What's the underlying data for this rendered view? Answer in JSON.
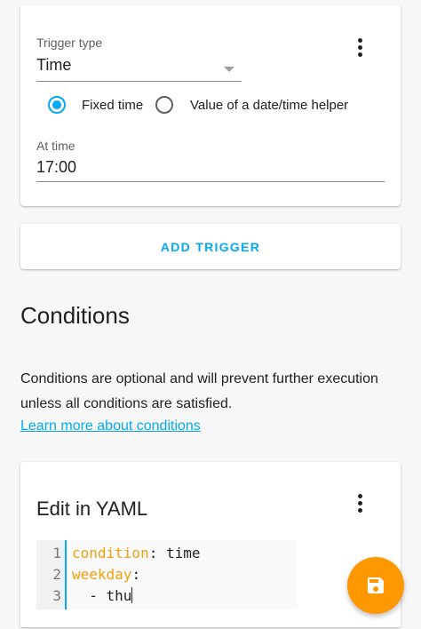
{
  "trigger": {
    "type_label": "Trigger type",
    "type_value": "Time",
    "radio_fixed_label": "Fixed time",
    "radio_helper_label": "Value of a date/time helper",
    "radio_selected": "fixed",
    "at_time_label": "At time",
    "at_time_value": "17:00"
  },
  "add_trigger_label": "ADD TRIGGER",
  "conditions": {
    "title": "Conditions",
    "description": "Conditions are optional and will prevent further execution unless all conditions are satisfied.",
    "learn_more": "Learn more about conditions"
  },
  "yaml": {
    "title": "Edit in YAML",
    "lines": [
      {
        "num": "1",
        "key": "condition",
        "sep": ": ",
        "value": "time"
      },
      {
        "num": "2",
        "key": "weekday",
        "sep": ":",
        "value": ""
      },
      {
        "num": "3",
        "key": "",
        "sep": "",
        "value": "  - thu"
      }
    ]
  },
  "icons": {
    "menu": "dots-vertical-icon",
    "fab": "save-icon",
    "dropdown": "caret-down-icon"
  },
  "colors": {
    "accent": "#03a9f4",
    "fab": "#ff9800",
    "yaml_key": "#f29e0d"
  }
}
